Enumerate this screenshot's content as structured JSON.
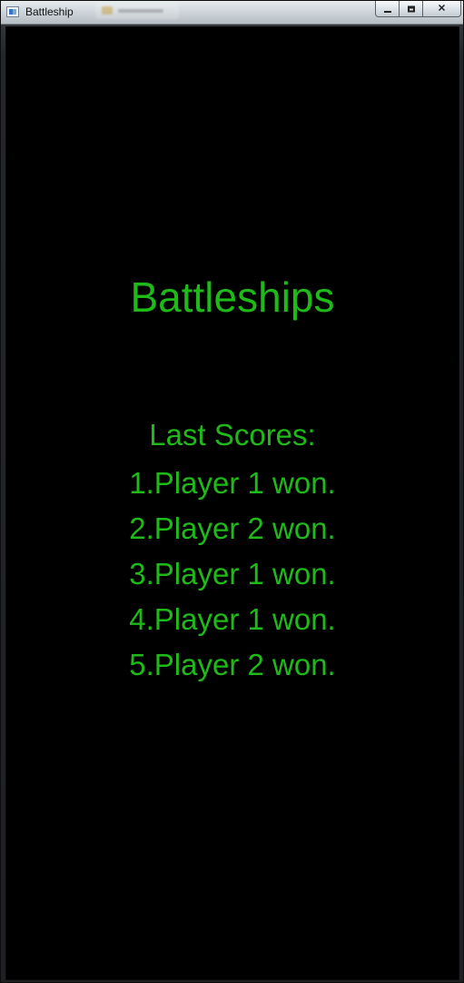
{
  "window": {
    "title": "Battleship",
    "controls": {
      "minimize_icon": "minimize-icon",
      "maximize_icon": "maximize-icon",
      "close_icon": "close-icon",
      "close_glyph": "✕"
    }
  },
  "game": {
    "title": "Battleships",
    "scores_heading": "Last Scores:",
    "scores": [
      "1.Player 1 won.",
      "2.Player 2 won.",
      "3.Player 1 won.",
      "4.Player 1 won.",
      "5.Player 2 won."
    ],
    "text_color": "#1fba19",
    "background_color": "#000000"
  }
}
